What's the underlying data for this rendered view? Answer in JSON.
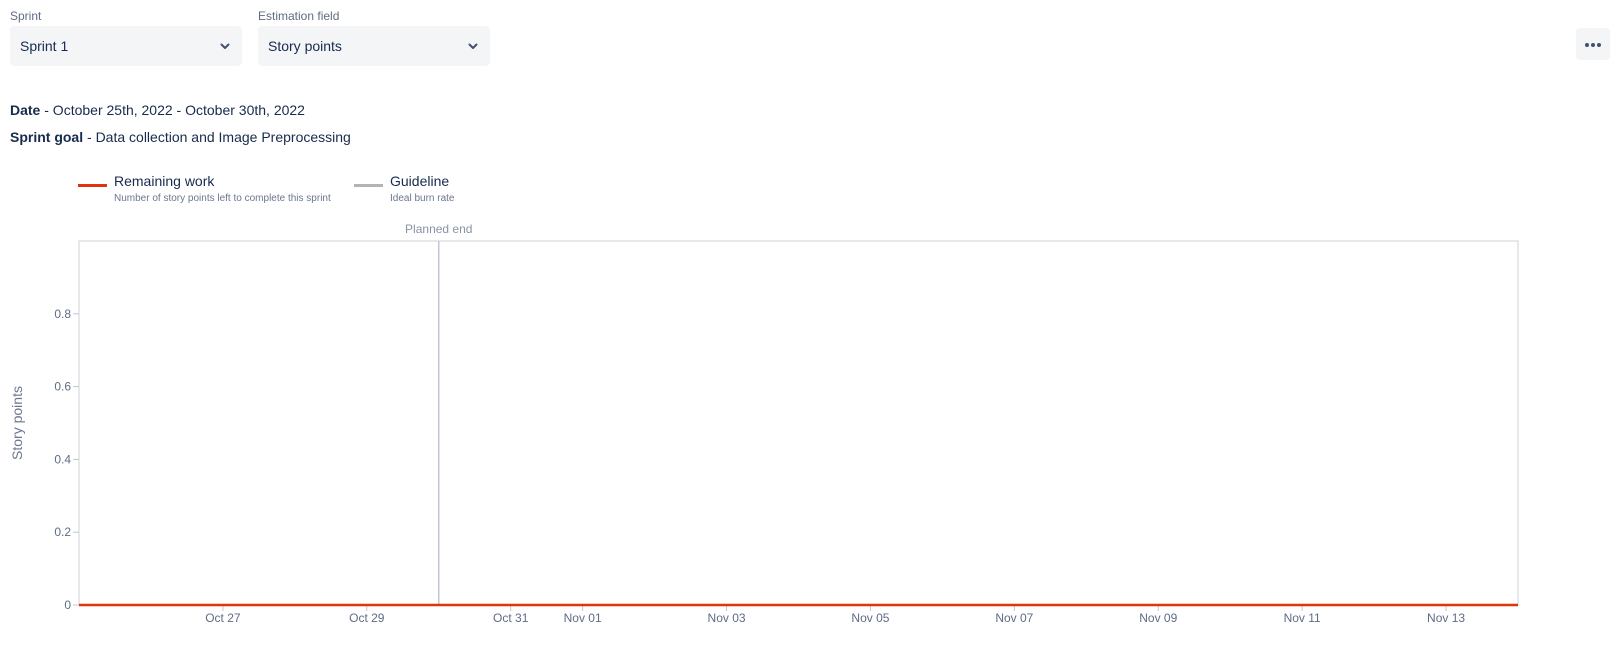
{
  "filters": {
    "sprint": {
      "label": "Sprint",
      "value": "Sprint 1"
    },
    "estimation": {
      "label": "Estimation field",
      "value": "Story points"
    }
  },
  "more_actions_icon": "more-horizontal-icon",
  "sprint_info": {
    "date_label": "Date",
    "date_value": " - October 25th, 2022 - October 30th, 2022",
    "goal_label": "Sprint goal",
    "goal_value": " - Data collection and Image Preprocessing"
  },
  "legend": [
    {
      "title": "Remaining work",
      "description": "Number of story points left to complete this sprint",
      "color": "#de350b"
    },
    {
      "title": "Guideline",
      "description": "Ideal burn rate",
      "color": "#b3b3b3"
    }
  ],
  "chart_data": {
    "type": "line",
    "ylabel": "Story points",
    "xlabel": "",
    "x_range": [
      "2022-10-25",
      "2022-11-14"
    ],
    "x_ticks": [
      "Oct 27",
      "Oct 29",
      "Oct 31",
      "Nov 01",
      "Nov 03",
      "Nov 05",
      "Nov 07",
      "Nov 09",
      "Nov 11",
      "Nov 13"
    ],
    "x_tick_dates": [
      "2022-10-27",
      "2022-10-29",
      "2022-10-31",
      "2022-11-01",
      "2022-11-03",
      "2022-11-05",
      "2022-11-07",
      "2022-11-09",
      "2022-11-11",
      "2022-11-13"
    ],
    "ylim": [
      0,
      1
    ],
    "y_ticks": [
      "0",
      "0.2",
      "0.4",
      "0.6",
      "0.8"
    ],
    "y_tick_values": [
      0,
      0.2,
      0.4,
      0.6,
      0.8
    ],
    "series": [
      {
        "name": "Remaining work",
        "x": [
          "2022-10-25",
          "2022-11-14"
        ],
        "values": [
          0,
          0
        ],
        "color": "#de350b"
      }
    ],
    "markers": [
      {
        "label": "Planned end",
        "x": "2022-10-30"
      }
    ],
    "grid": false
  }
}
